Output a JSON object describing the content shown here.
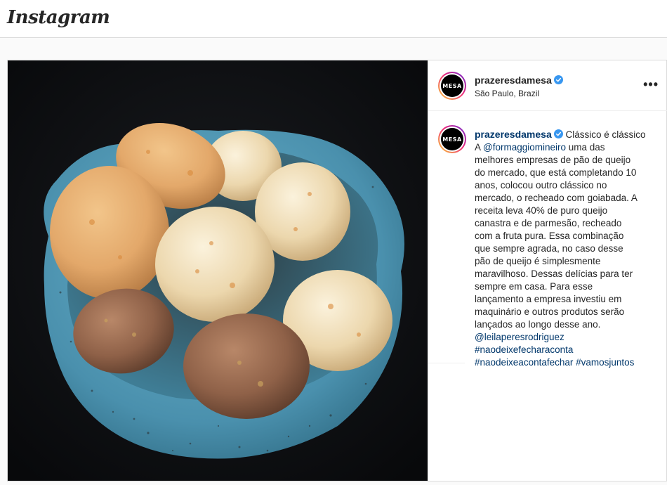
{
  "app": {
    "logo_text": "Instagram"
  },
  "post": {
    "username": "prazeresdamesa",
    "verified": true,
    "location": "São Paulo, Brazil",
    "more_label": "•••",
    "avatar_text": "MESA",
    "image_alt": "Bowl of pão de queijo",
    "caption": {
      "first_text": "Clássico é clássico",
      "mention": "@formaggiomineiro",
      "lines": [
        "uma das",
        "melhores empresas de pão de queijo",
        "do mercado, que está completando 10",
        "anos, colocou outro clássico no",
        "mercado, o recheado com goiabada. A",
        "receita leva 40% de puro queijo",
        "canastra e de parmesão, recheado",
        "com a fruta pura. Essa combinação",
        "que sempre agrada, no caso desse",
        "pão de queijo é simplesmente",
        "maravilhoso. Dessas delícias para ter",
        "sempre em casa. Para esse",
        "lançamento a empresa investiu em",
        "maquinário e outros produtos serão",
        "lançados ao longo desse ano."
      ],
      "credit_mention": "@leilaperesrodriguez",
      "hashtags": [
        "#naodeixefecharaconta",
        "#naodeixeacontafechar",
        "#vamosjuntos"
      ]
    }
  },
  "colors": {
    "link": "#00376b",
    "verified": "#3897f0",
    "border": "#dbdbdb",
    "bowl": "#4f9cb8"
  }
}
